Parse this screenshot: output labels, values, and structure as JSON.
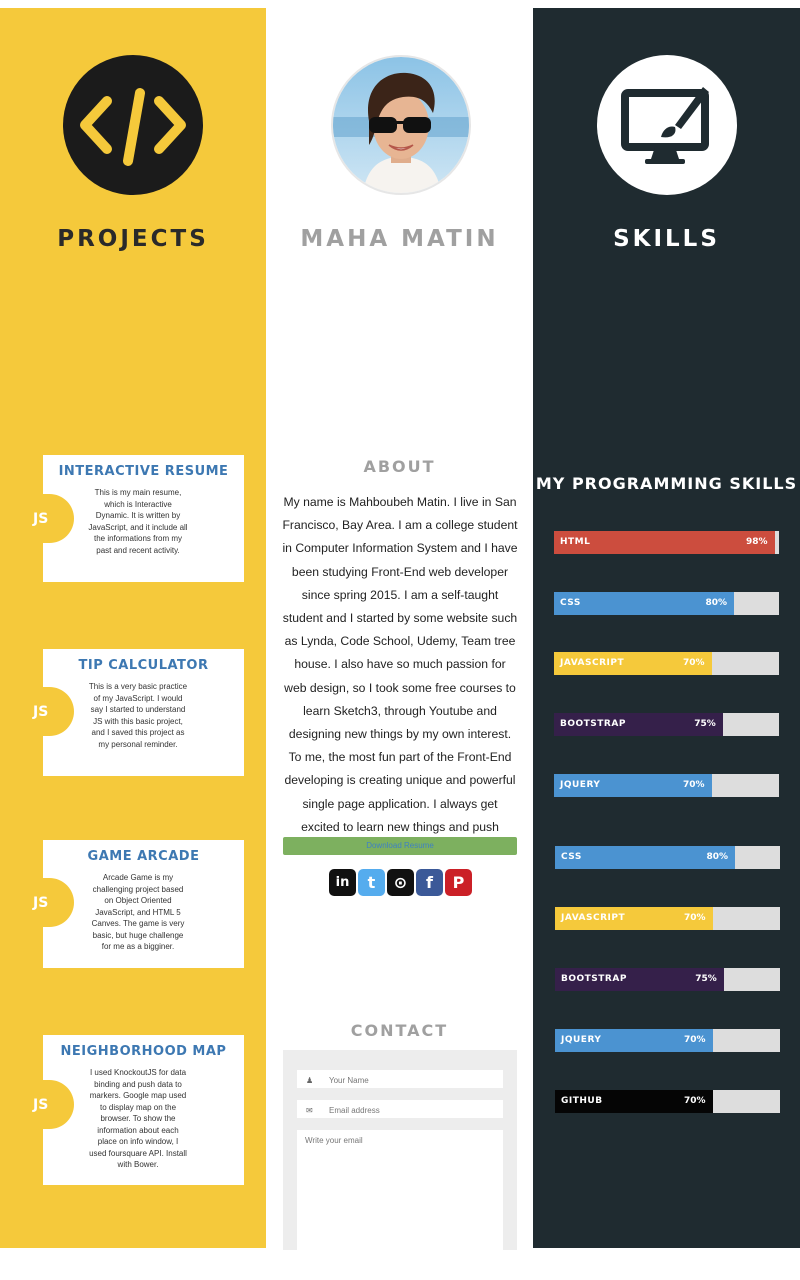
{
  "projects": {
    "heading": "PROJECTS",
    "cards": [
      {
        "title": "INTERACTIVE RESUME",
        "badge": "JS",
        "desc": "This is my main resume, which is Interactive Dynamic. It is written by JavaScript, and it include all the informations from my past and recent activity."
      },
      {
        "title": "TIP CALCULATOR",
        "badge": "JS",
        "desc": "This is a very basic practice of my JavaScript. I would say I started to understand JS with this basic project, and I saved this project as my personal reminder."
      },
      {
        "title": "GAME ARCADE",
        "badge": "JS",
        "desc": "Arcade Game is my challenging project based on Object Oriented JavaScript, and HTML 5 Canves. The game is very basic, but huge challenge for me as a bigginer."
      },
      {
        "title": "NEIGHBORHOOD MAP",
        "badge": "JS",
        "desc": "I used KnockoutJS for data binding and push data to markers. Google map used to display map on the browser. To show the information about each place on info window, I used foursquare API. Install with Bower."
      }
    ]
  },
  "profile": {
    "name": "MAHA MATIN",
    "about_heading": "ABOUT",
    "about_text": "My name is Mahboubeh Matin. I live in San Francisco, Bay Area. I am a college student in Computer Information System and I have been studying Front-End web developer since spring 2015. I am a self-taught student and I started by some website such as Lynda, Code School, Udemy, Team tree house. I also have so much passion for web design, so I took some free courses to learn Sketch3, through Youtube and designing new things by my own interest. To me, the most fun part of the Front-End developing is creating unique and powerful single page application. I always get excited to learn new things and push myself to next level. I enjoy",
    "download_label": "Download Resume",
    "social": [
      {
        "icon": "linkedin-icon",
        "glyph": "in",
        "color": "#111111"
      },
      {
        "icon": "twitter-icon",
        "glyph": "t",
        "color": "#55acee"
      },
      {
        "icon": "github-icon",
        "glyph": "⊙",
        "color": "#111111"
      },
      {
        "icon": "facebook-icon",
        "glyph": "f",
        "color": "#3b5998"
      },
      {
        "icon": "pinterest-icon",
        "glyph": "P",
        "color": "#cb2027"
      }
    ],
    "contact_heading": "CONTACT",
    "contact": {
      "name_placeholder": "Your Name",
      "email_placeholder": "Email address",
      "message_placeholder": "Write your email"
    }
  },
  "skills": {
    "heading": "SKILLS",
    "subheading": "MY PROGRAMMING SKILLS",
    "bars": [
      {
        "label": "HTML",
        "percent": 98,
        "percent_text": "98%",
        "color": "#cc4d3e"
      },
      {
        "label": "CSS",
        "percent": 80,
        "percent_text": "80%",
        "color": "#4b93d1"
      },
      {
        "label": "JAVASCRIPT",
        "percent": 70,
        "percent_text": "70%",
        "color": "#f5c93b"
      },
      {
        "label": "BOOTSTRAP",
        "percent": 75,
        "percent_text": "75%",
        "color": "#35204a"
      },
      {
        "label": "JQUERY",
        "percent": 70,
        "percent_text": "70%",
        "color": "#4b93d1"
      },
      {
        "label": "CSS",
        "percent": 80,
        "percent_text": "80%",
        "color": "#4b93d1"
      },
      {
        "label": "JAVASCRIPT",
        "percent": 70,
        "percent_text": "70%",
        "color": "#f5c93b"
      },
      {
        "label": "BOOTSTRAP",
        "percent": 75,
        "percent_text": "75%",
        "color": "#35204a"
      },
      {
        "label": "JQUERY",
        "percent": 70,
        "percent_text": "70%",
        "color": "#4b93d1"
      },
      {
        "label": "GITHUB",
        "percent": 70,
        "percent_text": "70%",
        "color": "#050505"
      }
    ]
  }
}
